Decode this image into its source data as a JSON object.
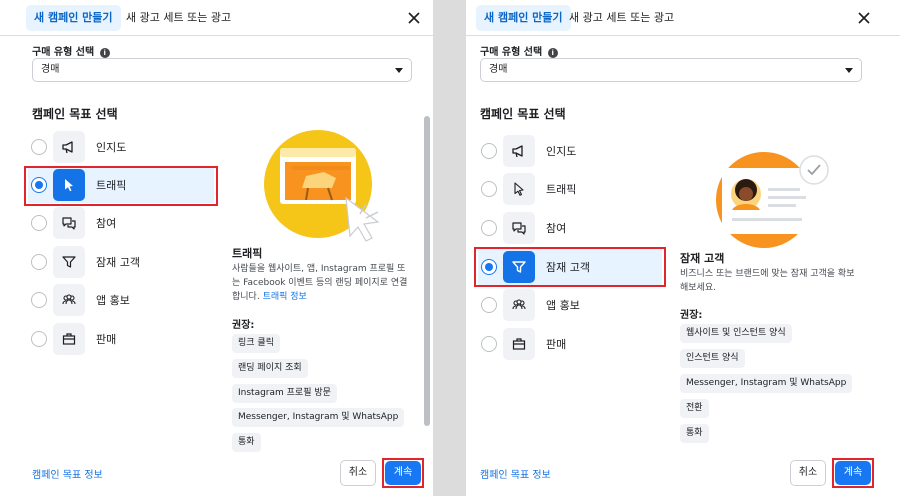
{
  "left_panel": {
    "tabs": {
      "new_campaign": "새 캠페인 만들기",
      "new_adset": "새 광고 세트 또는 광고"
    },
    "buying_type_label": "구매 유형 선택",
    "buying_type_value": "경매",
    "section_title": "캠페인 목표 선택",
    "options": [
      {
        "label": "인지도",
        "icon": "megaphone-icon"
      },
      {
        "label": "트래픽",
        "icon": "cursor-icon"
      },
      {
        "label": "참여",
        "icon": "chat-bubbles-icon"
      },
      {
        "label": "잠재 고객",
        "icon": "funnel-icon"
      },
      {
        "label": "앱 홍보",
        "icon": "people-icon"
      },
      {
        "label": "판매",
        "icon": "briefcase-icon"
      }
    ],
    "selected_option": "트래픽",
    "description": {
      "title": "트래픽",
      "text": "사람들을 웹사이트, 앱, Instagram 프로필 또는 Facebook 이벤트 등의 랜딩 페이지로 연결합니다.",
      "link": "트래픽 정보"
    },
    "recommended_label": "권장:",
    "recommended": [
      "링크 클릭",
      "랜딩 페이지 조회",
      "Instagram 프로필 방문",
      "Messenger, Instagram 및 WhatsApp",
      "통화"
    ],
    "footer_link": "캠페인 목표 정보",
    "cancel_label": "취소",
    "continue_label": "계속"
  },
  "right_panel": {
    "tabs": {
      "new_campaign": "새 캠페인 만들기",
      "new_adset": "새 광고 세트 또는 광고"
    },
    "buying_type_label": "구매 유형 선택",
    "buying_type_value": "경매",
    "section_title": "캠페인 목표 선택",
    "options": [
      {
        "label": "인지도",
        "icon": "megaphone-icon"
      },
      {
        "label": "트래픽",
        "icon": "cursor-icon"
      },
      {
        "label": "참여",
        "icon": "chat-bubbles-icon"
      },
      {
        "label": "잠재 고객",
        "icon": "funnel-icon"
      },
      {
        "label": "앱 홍보",
        "icon": "people-icon"
      },
      {
        "label": "판매",
        "icon": "briefcase-icon"
      }
    ],
    "selected_option": "잠재 고객",
    "description": {
      "title": "잠재 고객",
      "text": "비즈니스 또는 브랜드에 맞는 잠재 고객을 확보해보세요."
    },
    "recommended_label": "권장:",
    "recommended": [
      "웹사이트 및 인스턴트 양식",
      "인스턴트 양식",
      "Messenger, Instagram 및 WhatsApp",
      "전환",
      "통화"
    ],
    "footer_link": "캠페인 목표 정보",
    "cancel_label": "취소",
    "continue_label": "계속"
  },
  "colors": {
    "accent": "#1877f2",
    "selected_bg": "#e7f3ff",
    "highlight": "#e0262c",
    "illustration_orange": "#f7931e",
    "illustration_yellow": "#f5c518"
  }
}
